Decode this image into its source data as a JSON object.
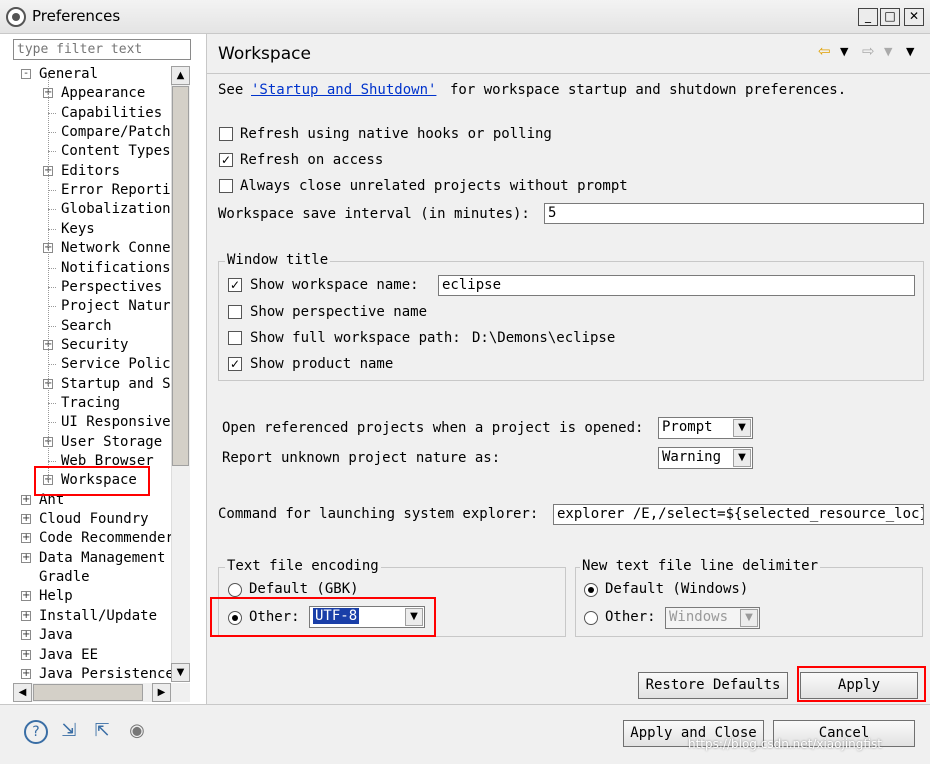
{
  "window": {
    "title": "Preferences",
    "min": "_",
    "max": "□",
    "close": "✕"
  },
  "filter": {
    "placeholder": "type filter text"
  },
  "tree": [
    {
      "label": "General",
      "level": 0,
      "expander": "-"
    },
    {
      "label": "Appearance",
      "level": 1,
      "expander": "+"
    },
    {
      "label": "Capabilities",
      "level": 1,
      "expander": ""
    },
    {
      "label": "Compare/Patch",
      "level": 1,
      "expander": ""
    },
    {
      "label": "Content Types",
      "level": 1,
      "expander": ""
    },
    {
      "label": "Editors",
      "level": 1,
      "expander": "+"
    },
    {
      "label": "Error Reporting",
      "level": 1,
      "expander": ""
    },
    {
      "label": "Globalization",
      "level": 1,
      "expander": ""
    },
    {
      "label": "Keys",
      "level": 1,
      "expander": ""
    },
    {
      "label": "Network Connections",
      "level": 1,
      "expander": "+"
    },
    {
      "label": "Notifications",
      "level": 1,
      "expander": ""
    },
    {
      "label": "Perspectives",
      "level": 1,
      "expander": ""
    },
    {
      "label": "Project Natures",
      "level": 1,
      "expander": ""
    },
    {
      "label": "Search",
      "level": 1,
      "expander": ""
    },
    {
      "label": "Security",
      "level": 1,
      "expander": "+"
    },
    {
      "label": "Service Policies",
      "level": 1,
      "expander": ""
    },
    {
      "label": "Startup and Shutdown",
      "level": 1,
      "expander": "+"
    },
    {
      "label": "Tracing",
      "level": 1,
      "expander": ""
    },
    {
      "label": "UI Responsiveness",
      "level": 1,
      "expander": ""
    },
    {
      "label": "User Storage",
      "level": 1,
      "expander": "+"
    },
    {
      "label": "Web Browser",
      "level": 1,
      "expander": ""
    },
    {
      "label": "Workspace",
      "level": 1,
      "expander": "+"
    },
    {
      "label": "Ant",
      "level": 0,
      "expander": "+"
    },
    {
      "label": "Cloud Foundry",
      "level": 0,
      "expander": "+"
    },
    {
      "label": "Code Recommenders",
      "level": 0,
      "expander": "+"
    },
    {
      "label": "Data Management",
      "level": 0,
      "expander": "+"
    },
    {
      "label": "Gradle",
      "level": 0,
      "expander": ""
    },
    {
      "label": "Help",
      "level": 0,
      "expander": "+"
    },
    {
      "label": "Install/Update",
      "level": 0,
      "expander": "+"
    },
    {
      "label": "Java",
      "level": 0,
      "expander": "+"
    },
    {
      "label": "Java EE",
      "level": 0,
      "expander": "+"
    },
    {
      "label": "Java Persistence",
      "level": 0,
      "expander": "+"
    }
  ],
  "page": {
    "title": "Workspace",
    "see_prefix": "See",
    "see_link": "'Startup and Shutdown'",
    "see_suffix": "for workspace startup and shutdown preferences.",
    "refresh_native": "Refresh using native hooks or polling",
    "refresh_access": "Refresh on access",
    "always_close": "Always close unrelated projects without prompt",
    "save_interval_label": "Workspace save interval (in minutes):",
    "save_interval_value": "5",
    "window_title_group": "Window title",
    "show_ws_name": "Show workspace name:",
    "ws_name_value": "eclipse",
    "show_perspective": "Show perspective name",
    "show_full_path": "Show full workspace path:",
    "full_path_value": "D:\\Demons\\eclipse",
    "show_product": "Show product name",
    "open_ref_label": "Open referenced projects when a project is opened:",
    "open_ref_value": "Prompt",
    "unknown_nature_label": "Report unknown project nature as:",
    "unknown_nature_value": "Warning",
    "cmd_label": "Command for launching system explorer:",
    "cmd_value": "explorer /E,/select=${selected_resource_loc}",
    "encoding_group": "Text file encoding",
    "enc_default": "Default (GBK)",
    "enc_other": "Other:",
    "enc_value": "UTF-8",
    "delim_group": "New text file line delimiter",
    "delim_default": "Default (Windows)",
    "delim_other": "Other:",
    "delim_value": "Windows",
    "restore_defaults": "Restore Defaults",
    "apply": "Apply"
  },
  "bottom": {
    "apply_close": "Apply and Close",
    "cancel": "Cancel",
    "watermark": "https://blog.csdn.net/xiaojingfist",
    "icons": [
      "help-icon",
      "import-icon",
      "export-icon",
      "record-icon"
    ]
  },
  "colors": {
    "highlight": "#ff0000",
    "link": "#0033cc"
  }
}
